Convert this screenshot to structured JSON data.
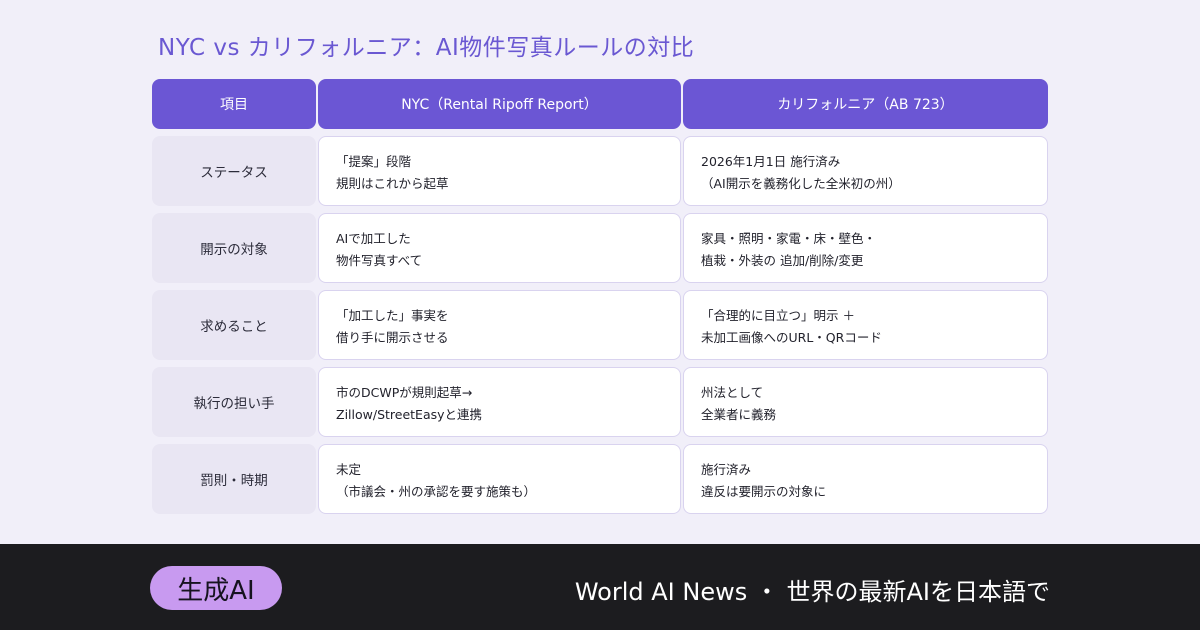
{
  "title": "NYC vs カリフォルニア：AI物件写真ルールの対比",
  "table": {
    "headers": [
      "項目",
      "NYC（Rental Ripoff Report）",
      "カリフォルニア（AB 723）"
    ],
    "rows": [
      {
        "label": "ステータス",
        "nyc": [
          "「提案」段階",
          "規則はこれから起草"
        ],
        "ca": [
          "2026年1月1日 施行済み",
          "（AI開示を義務化した全米初の州）"
        ]
      },
      {
        "label": "開示の対象",
        "nyc": [
          "AIで加工した",
          "物件写真すべて"
        ],
        "ca": [
          "家具・照明・家電・床・壁色・",
          "植栽・外装の 追加/削除/変更"
        ]
      },
      {
        "label": "求めること",
        "nyc": [
          "「加工した」事実を",
          "借り手に開示させる"
        ],
        "ca": [
          "「合理的に目立つ」明示 ＋",
          "未加工画像へのURL・QRコード"
        ]
      },
      {
        "label": "執行の担い手",
        "nyc": [
          "市のDCWPが規則起草→",
          "Zillow/StreetEasyと連携"
        ],
        "ca": [
          "州法として",
          "全業者に義務"
        ]
      },
      {
        "label": "罰則・時期",
        "nyc": [
          "未定",
          "（市議会・州の承認を要す施策も）"
        ],
        "ca": [
          "施行済み",
          "違反は要開示の対象に"
        ]
      }
    ]
  },
  "footer": {
    "badge": "生成AI",
    "tagline": "World AI News ・ 世界の最新AIを日本語で"
  },
  "colors": {
    "accent": "#6b56d4",
    "badge": "#c89af0",
    "footer_bg": "#1c1c1f",
    "page_bg": "#f1eff9"
  }
}
